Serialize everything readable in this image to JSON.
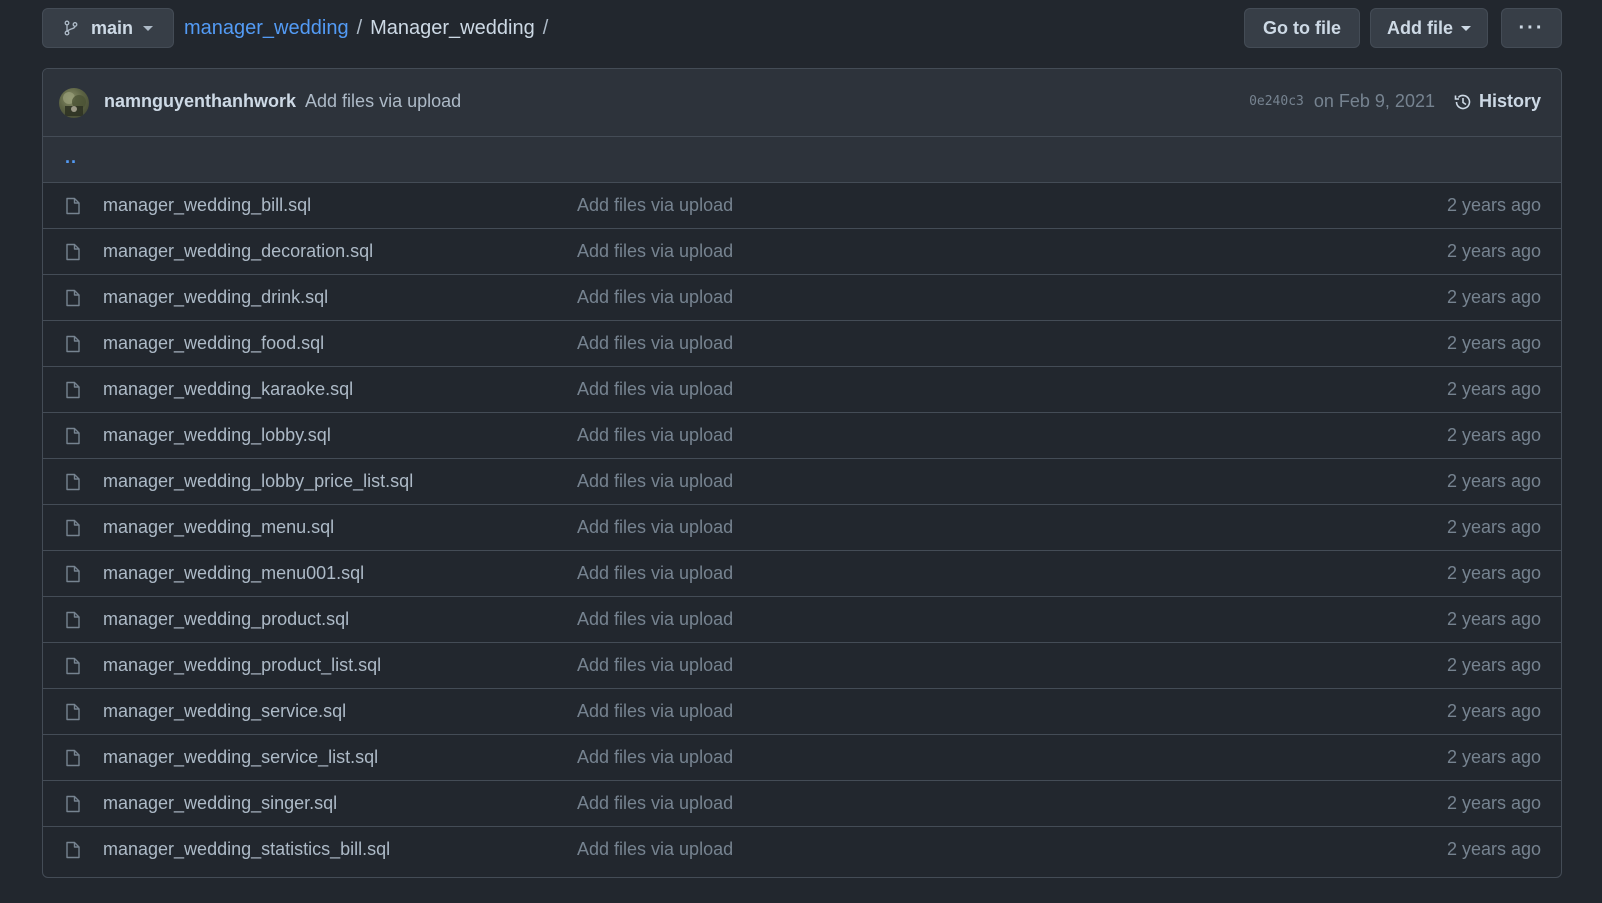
{
  "branch": {
    "name": "main",
    "icon": "git-branch-icon"
  },
  "breadcrumb": {
    "repo": "manager_wedding",
    "separator": "/",
    "directory": "Manager_wedding",
    "trailing_separator": "/"
  },
  "actions": {
    "go_to_file": "Go to file",
    "add_file": "Add file",
    "more": "···"
  },
  "latest_commit": {
    "author": "namnguyenthanhwork",
    "message": "Add files via upload",
    "sha": "0e240c3",
    "date": "on Feb 9, 2021",
    "history_label": "History",
    "history_icon": "history-icon"
  },
  "parent_dir": "..",
  "files": [
    {
      "name": "manager_wedding_bill.sql",
      "commit": "Add files via upload",
      "age": "2 years ago"
    },
    {
      "name": "manager_wedding_decoration.sql",
      "commit": "Add files via upload",
      "age": "2 years ago"
    },
    {
      "name": "manager_wedding_drink.sql",
      "commit": "Add files via upload",
      "age": "2 years ago"
    },
    {
      "name": "manager_wedding_food.sql",
      "commit": "Add files via upload",
      "age": "2 years ago"
    },
    {
      "name": "manager_wedding_karaoke.sql",
      "commit": "Add files via upload",
      "age": "2 years ago"
    },
    {
      "name": "manager_wedding_lobby.sql",
      "commit": "Add files via upload",
      "age": "2 years ago"
    },
    {
      "name": "manager_wedding_lobby_price_list.sql",
      "commit": "Add files via upload",
      "age": "2 years ago"
    },
    {
      "name": "manager_wedding_menu.sql",
      "commit": "Add files via upload",
      "age": "2 years ago"
    },
    {
      "name": "manager_wedding_menu001.sql",
      "commit": "Add files via upload",
      "age": "2 years ago"
    },
    {
      "name": "manager_wedding_product.sql",
      "commit": "Add files via upload",
      "age": "2 years ago"
    },
    {
      "name": "manager_wedding_product_list.sql",
      "commit": "Add files via upload",
      "age": "2 years ago"
    },
    {
      "name": "manager_wedding_service.sql",
      "commit": "Add files via upload",
      "age": "2 years ago"
    },
    {
      "name": "manager_wedding_service_list.sql",
      "commit": "Add files via upload",
      "age": "2 years ago"
    },
    {
      "name": "manager_wedding_singer.sql",
      "commit": "Add files via upload",
      "age": "2 years ago"
    },
    {
      "name": "manager_wedding_statistics_bill.sql",
      "commit": "Add files via upload",
      "age": "2 years ago"
    }
  ],
  "colors": {
    "background": "#22272e",
    "header_bg": "#2d333b",
    "border": "#444c56",
    "link": "#539bf5",
    "text": "#adbac7",
    "muted": "#768390"
  }
}
